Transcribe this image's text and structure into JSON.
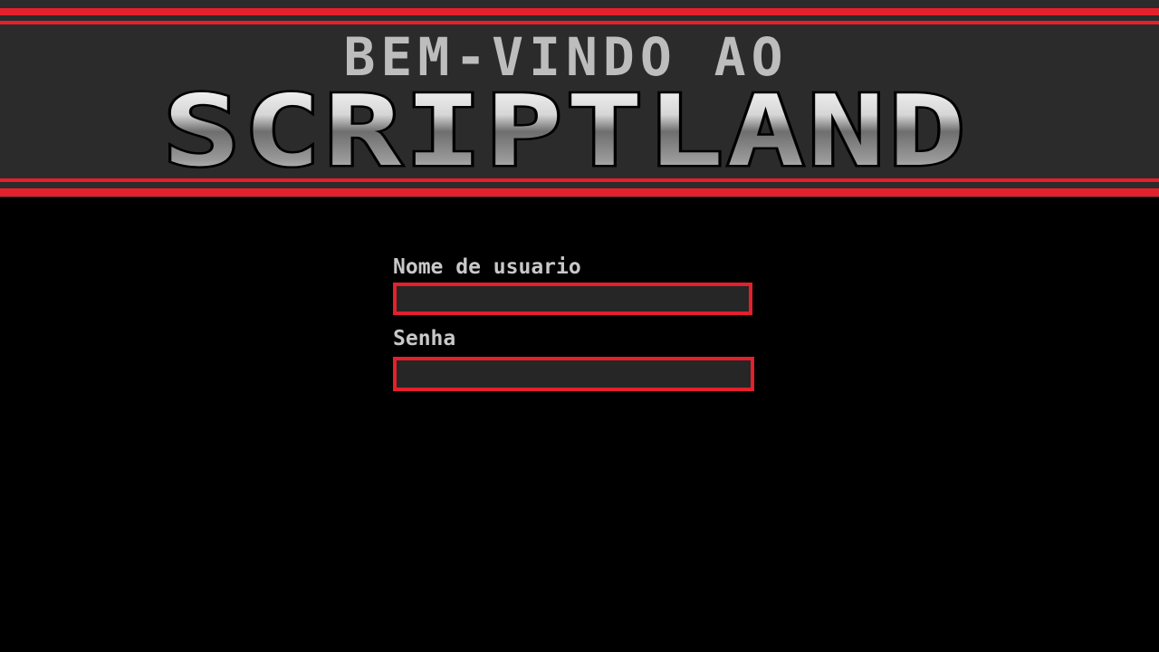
{
  "header": {
    "welcome_text": "BEM-VINDO AO",
    "logo_text": "SCRIPTLAND"
  },
  "login_form": {
    "username_label": "Nome de usuario",
    "username_value": "",
    "password_label": "Senha",
    "password_value": ""
  },
  "colors": {
    "background": "#000000",
    "banner": "#2b2b2b",
    "accent_red": "#e3202b",
    "label_text": "#c8c8c8",
    "input_fill": "#262626"
  }
}
